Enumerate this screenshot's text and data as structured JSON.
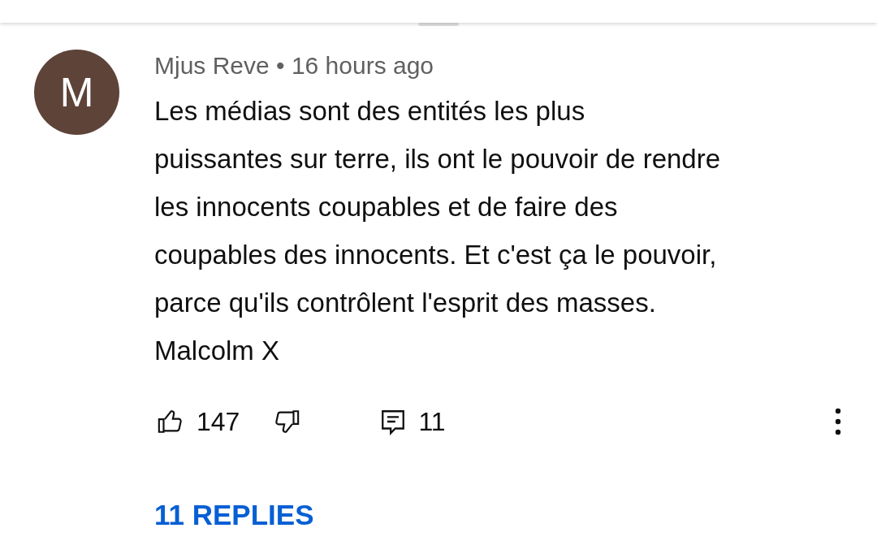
{
  "comment": {
    "avatar_letter": "M",
    "author": "Mjus Reve",
    "separator": "•",
    "time": "16 hours ago",
    "text": "Les médias sont des entités les plus\npuissantes sur terre, ils ont le pouvoir de rendre\nles innocents coupables et de faire des\ncoupables des innocents. Et c'est ça le pouvoir,\nparce qu'ils contrôlent l'esprit des masses.\nMalcolm X",
    "likes": "147",
    "replies_count": "11",
    "replies_link": "11 REPLIES"
  }
}
